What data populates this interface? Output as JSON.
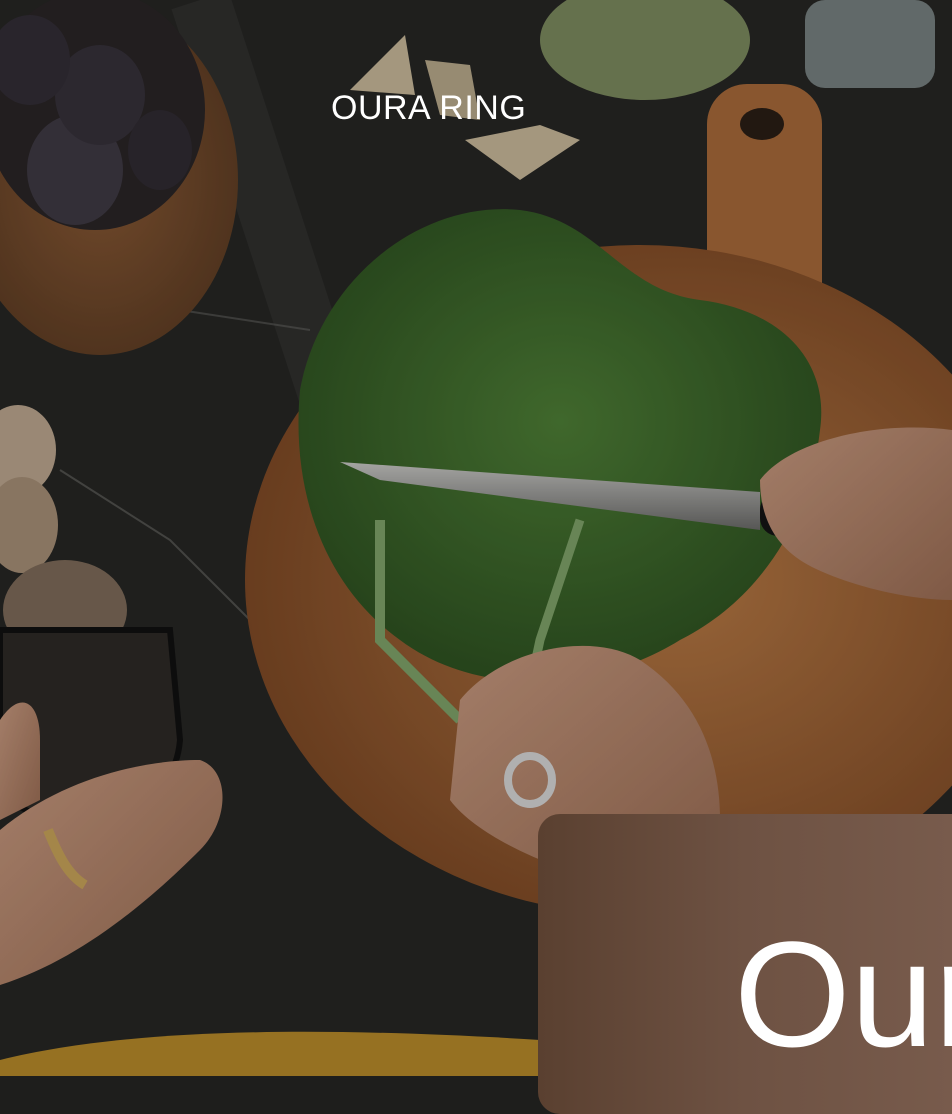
{
  "brand": {
    "label": "OURA RING"
  },
  "promo_card": {
    "title": "Our"
  },
  "colors": {
    "card_brown": "#6e5243",
    "counter_dark": "#262624",
    "board_wood": "#a8693a",
    "kale_green": "#3f6a2c"
  }
}
